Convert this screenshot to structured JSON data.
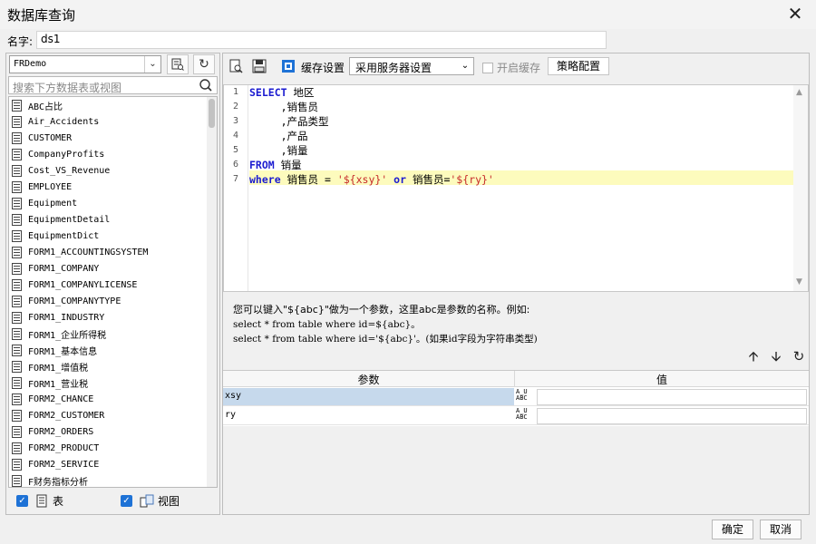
{
  "window": {
    "title": "数据库查询",
    "close": "✕"
  },
  "name": {
    "label": "名字:",
    "value": "ds1"
  },
  "left": {
    "datasource": "FRDemo",
    "search_placeholder": "搜索下方数据表或视图",
    "tables": [
      "ABC占比",
      "Air_Accidents",
      "CUSTOMER",
      "CompanyProfits",
      "Cost_VS_Revenue",
      "EMPLOYEE",
      "Equipment",
      "EquipmentDetail",
      "EquipmentDict",
      "FORM1_ACCOUNTINGSYSTEM",
      "FORM1_COMPANY",
      "FORM1_COMPANYLICENSE",
      "FORM1_COMPANYTYPE",
      "FORM1_INDUSTRY",
      "FORM1_企业所得税",
      "FORM1_基本信息",
      "FORM1_增值税",
      "FORM1_营业税",
      "FORM2_CHANCE",
      "FORM2_CUSTOMER",
      "FORM2_ORDERS",
      "FORM2_PRODUCT",
      "FORM2_SERVICE",
      "F财务指标分析"
    ],
    "show_tables_label": "表",
    "show_views_label": "视图"
  },
  "toolbar": {
    "cache_label": "缓存设置",
    "cache_value": "采用服务器设置",
    "enable_cache_label": "开启缓存",
    "strategy_label": "策略配置"
  },
  "sql": {
    "line_numbers": [
      "1",
      "2",
      "3",
      "4",
      "5",
      "6",
      "7"
    ],
    "lines": [
      [
        {
          "t": "SELECT",
          "c": "kw"
        },
        {
          "t": " 地区",
          "c": ""
        }
      ],
      [
        {
          "t": "     ,销售员",
          "c": ""
        }
      ],
      [
        {
          "t": "     ,产品类型",
          "c": ""
        }
      ],
      [
        {
          "t": "     ,产品",
          "c": ""
        }
      ],
      [
        {
          "t": "     ,销量",
          "c": ""
        }
      ],
      [
        {
          "t": "FROM",
          "c": "kw"
        },
        {
          "t": " 销量",
          "c": ""
        }
      ],
      [
        {
          "t": "where",
          "c": "kw"
        },
        {
          "t": " 销售员 = ",
          "c": ""
        },
        {
          "t": "'${xsy}'",
          "c": "str"
        },
        {
          "t": " ",
          "c": ""
        },
        {
          "t": "or",
          "c": "kw"
        },
        {
          "t": " 销售员=",
          "c": ""
        },
        {
          "t": "'${ry}'",
          "c": "str"
        }
      ]
    ]
  },
  "hint": {
    "line1": "您可以键入\"${abc}\"做为一个参数，这里abc是参数的名称。例如:",
    "line2": "select * from table where id=${abc}。",
    "line3": "select * from table where id='${abc}'。(如果id字段为字符串类型)"
  },
  "params": {
    "header_name": "参数",
    "header_value": "值",
    "type_badge": "A̲U\nABC",
    "rows": [
      {
        "name": "xsy",
        "value": "",
        "selected": true
      },
      {
        "name": "ry",
        "value": "",
        "selected": false
      }
    ]
  },
  "footer": {
    "ok": "确定",
    "cancel": "取消"
  },
  "colors": {
    "keyword": "#1b1bd0",
    "string": "#c62a2a",
    "highlight": "#fdfbbd",
    "selected_row": "#c6d9ec",
    "checkbox": "#1e72d6"
  }
}
